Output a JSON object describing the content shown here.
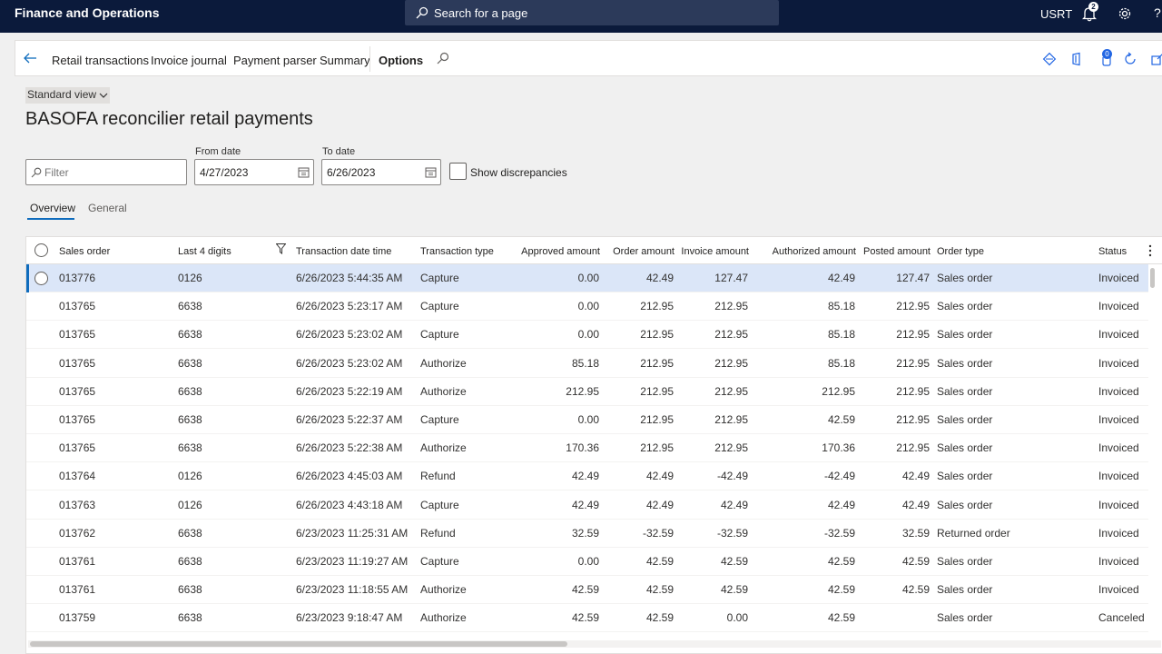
{
  "topbar": {
    "app_title": "Finance and Operations",
    "search_text": "Search for a page",
    "user": "USRT",
    "notification_count": "2",
    "help": "?"
  },
  "actionpane": {
    "items": [
      "Retail transactions",
      "Invoice journal",
      "Payment parser",
      "Summary",
      "Options"
    ],
    "badge": "0"
  },
  "view": {
    "name": "Standard view",
    "title": "BASOFA reconcilier retail payments"
  },
  "filters": {
    "filter_placeholder": "Filter",
    "from_label": "From date",
    "from_value": "4/27/2023",
    "to_label": "To date",
    "to_value": "6/26/2023",
    "show_discrepancies": "Show discrepancies"
  },
  "tabs": [
    "Overview",
    "General"
  ],
  "grid": {
    "columns": [
      "Sales order",
      "Last 4 digits",
      "Transaction date time",
      "Transaction type",
      "Approved amount",
      "Order amount",
      "Invoice amount",
      "Authorized amount",
      "Posted amount",
      "Order type",
      "Status"
    ],
    "rows": [
      [
        "013776",
        "0126",
        "6/26/2023 5:44:35 AM",
        "Capture",
        "0.00",
        "42.49",
        "127.47",
        "42.49",
        "127.47",
        "Sales order",
        "Invoiced"
      ],
      [
        "013765",
        "6638",
        "6/26/2023 5:23:17 AM",
        "Capture",
        "0.00",
        "212.95",
        "212.95",
        "85.18",
        "212.95",
        "Sales order",
        "Invoiced"
      ],
      [
        "013765",
        "6638",
        "6/26/2023 5:23:02 AM",
        "Capture",
        "0.00",
        "212.95",
        "212.95",
        "85.18",
        "212.95",
        "Sales order",
        "Invoiced"
      ],
      [
        "013765",
        "6638",
        "6/26/2023 5:23:02 AM",
        "Authorize",
        "85.18",
        "212.95",
        "212.95",
        "85.18",
        "212.95",
        "Sales order",
        "Invoiced"
      ],
      [
        "013765",
        "6638",
        "6/26/2023 5:22:19 AM",
        "Authorize",
        "212.95",
        "212.95",
        "212.95",
        "212.95",
        "212.95",
        "Sales order",
        "Invoiced"
      ],
      [
        "013765",
        "6638",
        "6/26/2023 5:22:37 AM",
        "Capture",
        "0.00",
        "212.95",
        "212.95",
        "42.59",
        "212.95",
        "Sales order",
        "Invoiced"
      ],
      [
        "013765",
        "6638",
        "6/26/2023 5:22:38 AM",
        "Authorize",
        "170.36",
        "212.95",
        "212.95",
        "170.36",
        "212.95",
        "Sales order",
        "Invoiced"
      ],
      [
        "013764",
        "0126",
        "6/26/2023 4:45:03 AM",
        "Refund",
        "42.49",
        "42.49",
        "-42.49",
        "-42.49",
        "42.49",
        "Sales order",
        "Invoiced"
      ],
      [
        "013763",
        "0126",
        "6/26/2023 4:43:18 AM",
        "Capture",
        "42.49",
        "42.49",
        "42.49",
        "42.49",
        "42.49",
        "Sales order",
        "Invoiced"
      ],
      [
        "013762",
        "6638",
        "6/23/2023 11:25:31 AM",
        "Refund",
        "32.59",
        "-32.59",
        "-32.59",
        "-32.59",
        "32.59",
        "Returned order",
        "Invoiced"
      ],
      [
        "013761",
        "6638",
        "6/23/2023 11:19:27 AM",
        "Capture",
        "0.00",
        "42.59",
        "42.59",
        "42.59",
        "42.59",
        "Sales order",
        "Invoiced"
      ],
      [
        "013761",
        "6638",
        "6/23/2023 11:18:55 AM",
        "Authorize",
        "42.59",
        "42.59",
        "42.59",
        "42.59",
        "42.59",
        "Sales order",
        "Invoiced"
      ],
      [
        "013759",
        "6638",
        "6/23/2023 9:18:47 AM",
        "Authorize",
        "42.59",
        "42.59",
        "0.00",
        "42.59",
        "",
        "Sales order",
        "Canceled"
      ]
    ]
  }
}
